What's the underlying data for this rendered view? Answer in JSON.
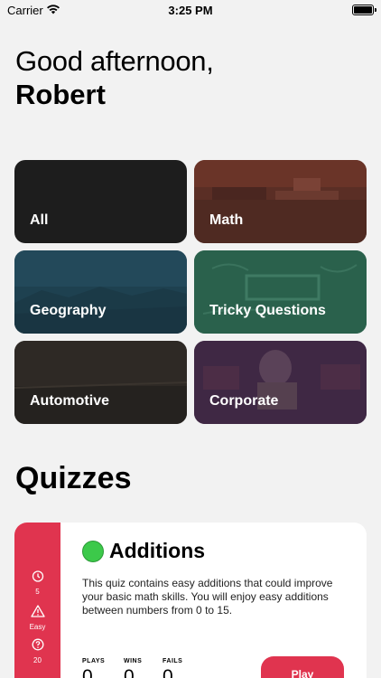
{
  "status_bar": {
    "carrier": "Carrier",
    "time": "3:25 PM"
  },
  "header": {
    "greeting": "Good afternoon,",
    "name": "Robert"
  },
  "categories": [
    {
      "label": "All",
      "color": "#1d1d1d"
    },
    {
      "label": "Math",
      "color": "#5a2e25"
    },
    {
      "label": "Geography",
      "color": "#1e4150"
    },
    {
      "label": "Tricky Questions",
      "color": "#265c48"
    },
    {
      "label": "Automotive",
      "color": "#2a2622"
    },
    {
      "label": "Corporate",
      "color": "#3f2844"
    }
  ],
  "quizzes": {
    "title": "Quizzes",
    "items": [
      {
        "title": "Additions",
        "description": "This quiz contains easy additions that could improve your basic math skills. You will enjoy easy additions between numbers from 0 to 15.",
        "time_value": "5",
        "difficulty": "Easy",
        "questions": "20",
        "stats": {
          "plays_label": "PLAYS",
          "plays": "0",
          "wins_label": "WINS",
          "wins": "0",
          "fails_label": "FAILS",
          "fails": "0"
        },
        "play_label": "Play",
        "accent_color": "#e0344f"
      }
    ]
  }
}
